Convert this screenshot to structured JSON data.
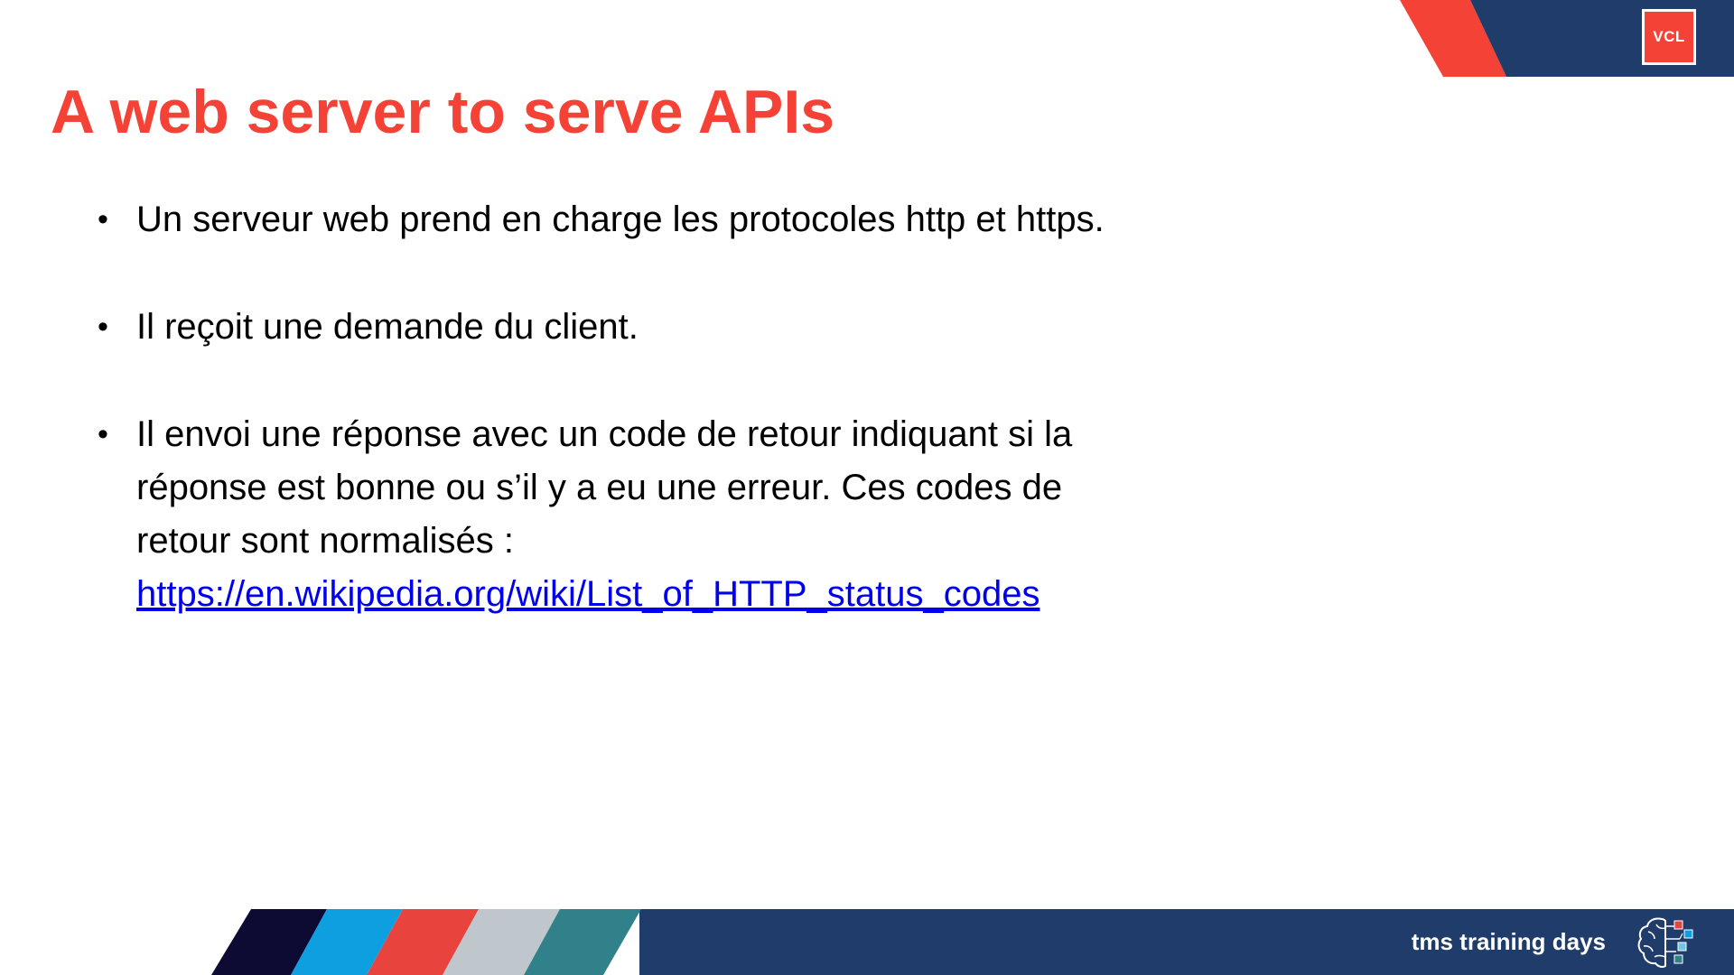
{
  "slide": {
    "logo_text": "VCL",
    "title": "A web server to serve APIs",
    "bullets": [
      {
        "text": "Un serveur web prend en charge les protocoles http et https.",
        "link": ""
      },
      {
        "text": "Il reçoit une demande du client.",
        "link": ""
      },
      {
        "text": "Il envoi une réponse avec un code de retour indiquant si la réponse est bonne ou s’il y a eu une erreur. Ces codes de retour sont normalisés :",
        "link": "https://en.wikipedia.org/wiki/List_of_HTTP_status_codes"
      }
    ],
    "bullet_glyph": "•",
    "footer_text": "tms training days",
    "footer_icon": "brain-circuit-icon"
  },
  "colors": {
    "accent_red": "#f44336",
    "navy": "#1f3c6b",
    "stripe_dark": "#0d0a33",
    "stripe_blue": "#0e9fe0",
    "stripe_red": "#e8433d",
    "stripe_grey": "#bfc6cc",
    "stripe_teal": "#31818b",
    "link_blue": "#0000ee"
  }
}
